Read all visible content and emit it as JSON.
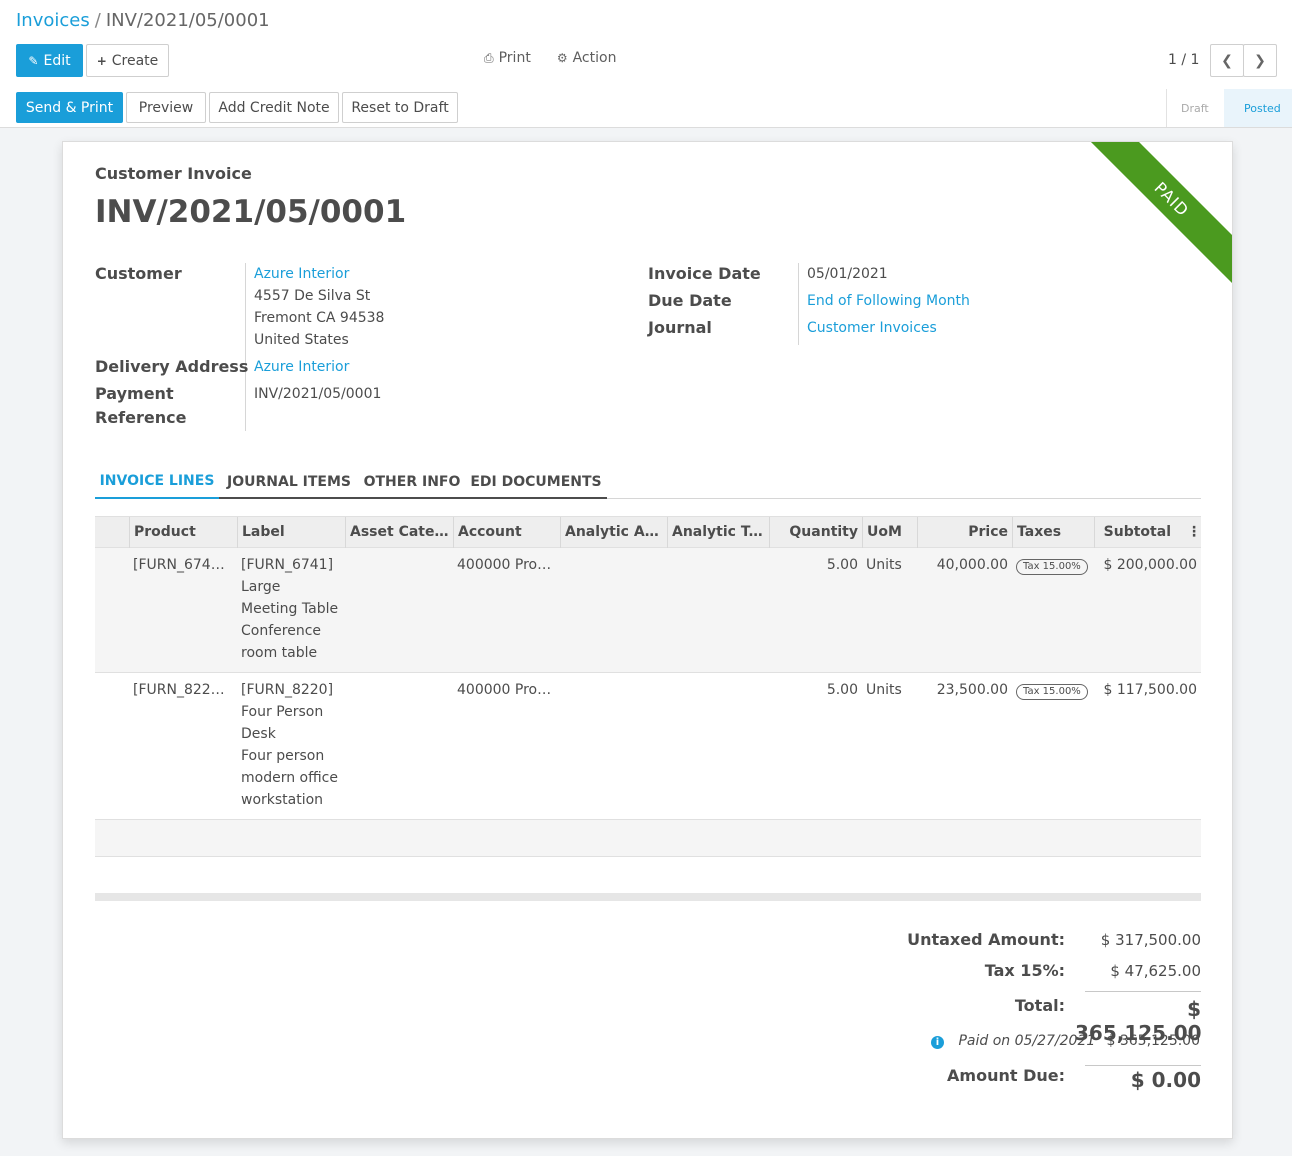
{
  "breadcrumb": {
    "parent": "Invoices",
    "separator": "/",
    "current": "INV/2021/05/0001"
  },
  "toolbar": {
    "edit": "Edit",
    "create": "Create",
    "print": "Print",
    "action": "Action",
    "pager": "1 / 1"
  },
  "actions": {
    "send_print": "Send & Print",
    "preview": "Preview",
    "credit_note": "Add Credit Note",
    "reset": "Reset to Draft"
  },
  "statusbar": {
    "draft": "Draft",
    "posted": "Posted"
  },
  "ribbon": "PAID",
  "header": {
    "type": "Customer Invoice",
    "name": "INV/2021/05/0001"
  },
  "left_fields": {
    "customer_label": "Customer",
    "customer_name": "Azure Interior",
    "address1": "4557 De Silva St",
    "address2": "Fremont CA 94538",
    "address3": "United States",
    "delivery_label": "Delivery Address",
    "delivery_value": "Azure Interior",
    "payref_label1": "Payment",
    "payref_label2": "Reference",
    "payref_value": "INV/2021/05/0001"
  },
  "right_fields": {
    "invoice_date_label": "Invoice Date",
    "invoice_date": "05/01/2021",
    "due_date_label": "Due Date",
    "due_date": "End of Following Month",
    "journal_label": "Journal",
    "journal": "Customer Invoices"
  },
  "tabs": [
    "INVOICE LINES",
    "JOURNAL ITEMS",
    "OTHER INFO",
    "EDI DOCUMENTS"
  ],
  "columns": [
    "Product",
    "Label",
    "Asset Categ…",
    "Account",
    "Analytic Acc…",
    "Analytic Tags",
    "Quantity",
    "UoM",
    "Price",
    "Taxes",
    "Subtotal"
  ],
  "lines": [
    {
      "product": "[FURN_6741…",
      "label": [
        "[FURN_6741]",
        "Large",
        "Meeting Table",
        "Conference",
        "room table"
      ],
      "account": "400000 Pro…",
      "quantity": "5.00",
      "uom": "Units",
      "price": "40,000.00",
      "tax": "Tax 15.00%",
      "subtotal": "$ 200,000.00"
    },
    {
      "product": "[FURN_822…",
      "label": [
        "[FURN_8220]",
        "Four Person",
        "Desk",
        "Four person",
        "modern office",
        "workstation"
      ],
      "account": "400000 Pro…",
      "quantity": "5.00",
      "uom": "Units",
      "price": "23,500.00",
      "tax": "Tax 15.00%",
      "subtotal": "$ 117,500.00"
    }
  ],
  "totals": {
    "untaxed_label": "Untaxed Amount:",
    "untaxed": "$ 317,500.00",
    "tax_label": "Tax 15%:",
    "tax": "$ 47,625.00",
    "total_label": "Total:",
    "total": "$ 365,125.00",
    "paid_label": "Paid on 05/27/2021",
    "paid": "$ 365,125.00",
    "due_label": "Amount Due:",
    "due": "$ 0.00"
  },
  "colors": {
    "primary": "#1a9ed9",
    "ribbon": "#4b9a1f"
  }
}
